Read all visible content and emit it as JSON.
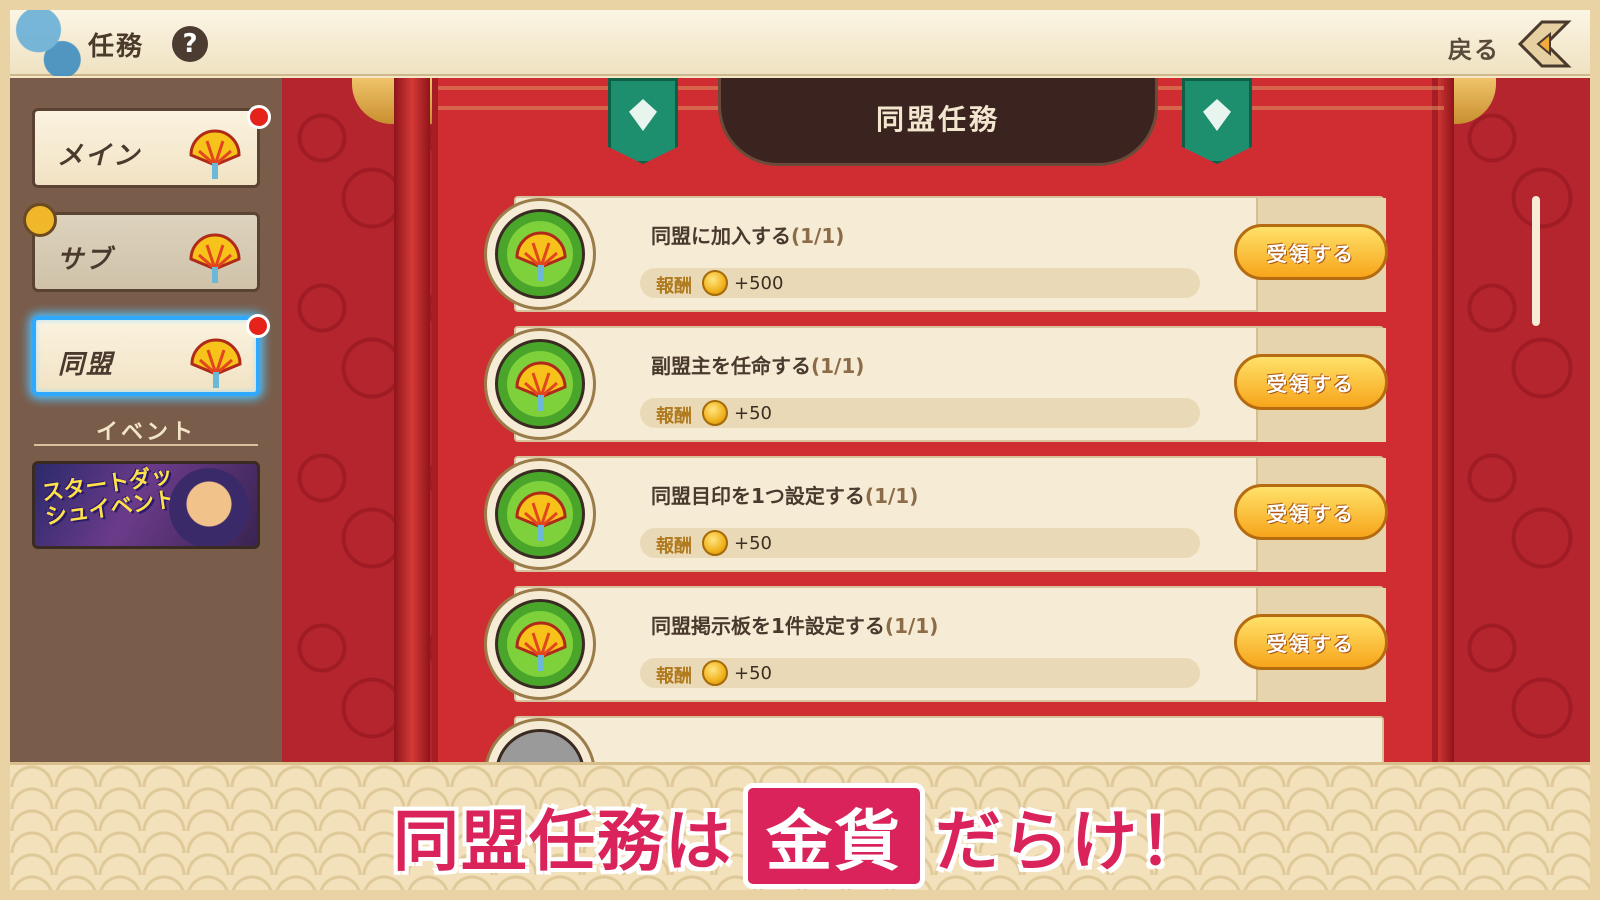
{
  "header": {
    "title": "任務",
    "help_label": "?",
    "back_label": "戻る"
  },
  "sidebar": {
    "tabs": [
      {
        "label": "メイン",
        "badge": true,
        "locked": false,
        "active": false
      },
      {
        "label": "サブ",
        "badge": false,
        "locked": true,
        "active": false
      },
      {
        "label": "同盟",
        "badge": true,
        "locked": false,
        "active": true
      }
    ],
    "event_heading": "イベント",
    "event_banner": "スタートダッシュイベント"
  },
  "board": {
    "title": "同盟任務",
    "tasks": [
      {
        "name": "同盟に加入する",
        "progress": "(1/1)",
        "reward_label": "報酬",
        "reward_amount": "+500",
        "claim_label": "受領する"
      },
      {
        "name": "副盟主を任命する",
        "progress": "(1/1)",
        "reward_label": "報酬",
        "reward_amount": "+50",
        "claim_label": "受領する"
      },
      {
        "name": "同盟目印を1つ設定する",
        "progress": "(1/1)",
        "reward_label": "報酬",
        "reward_amount": "+50",
        "claim_label": "受領する"
      },
      {
        "name": "同盟掲示板を1件設定する",
        "progress": "(1/1)",
        "reward_label": "報酬",
        "reward_amount": "+50",
        "claim_label": "受領する"
      }
    ]
  },
  "banner": {
    "part1": "同盟任務は",
    "boxed": "金貨",
    "part2": "だらけ！"
  },
  "colors": {
    "accent_red": "#cf2d32",
    "claim_button": "#f7a51b",
    "banner_pink": "#d9235a",
    "active_tab_glow": "#2fa8ff"
  }
}
